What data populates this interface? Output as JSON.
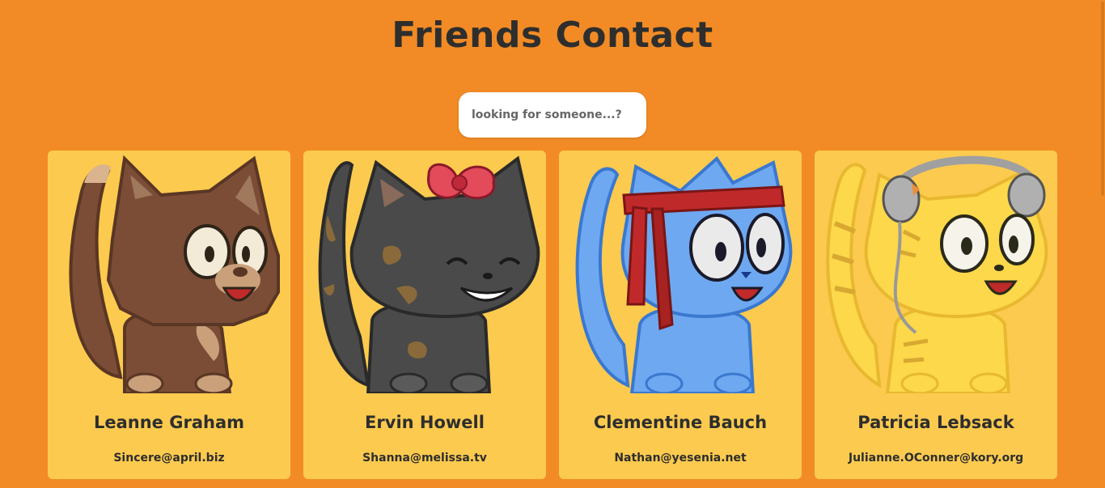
{
  "header": {
    "title": "Friends Contact"
  },
  "search": {
    "placeholder": "looking for someone...?",
    "value": ""
  },
  "friends": [
    {
      "name": "Leanne Graham",
      "email": "Sincere@april.biz",
      "avatar": "brown-cat-icon"
    },
    {
      "name": "Ervin Howell",
      "email": "Shanna@melissa.tv",
      "avatar": "black-cat-with-bow-icon"
    },
    {
      "name": "Clementine Bauch",
      "email": "Nathan@yesenia.net",
      "avatar": "blue-cat-with-headband-icon"
    },
    {
      "name": "Patricia Lebsack",
      "email": "Julianne.OConner@kory.org",
      "avatar": "yellow-cat-with-headphones-icon"
    }
  ],
  "colors": {
    "background": "#f28b25",
    "card": "#fcca4e",
    "text": "#2e2e2e"
  }
}
